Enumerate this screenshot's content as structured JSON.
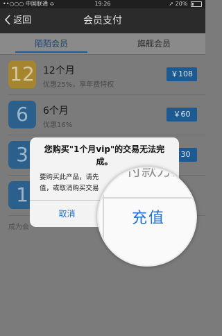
{
  "status_bar": {
    "carrier": "••○○○ 中国联通 ≎",
    "time": "19:26",
    "battery": "20%",
    "battery_level": 0.2
  },
  "nav": {
    "back_label": "返回",
    "title": "会员支付"
  },
  "tabs": [
    {
      "label": "陌陌会员",
      "active": true
    },
    {
      "label": "旗舰会员",
      "active": false
    }
  ],
  "products": [
    {
      "badge": "12",
      "badge_color": "#a5852d",
      "title": "12个月",
      "subtitle": "优惠25%，享年费特权",
      "price": "￥108"
    },
    {
      "badge": "6",
      "badge_color": "#2b5f8c",
      "title": "6个月",
      "subtitle": "优惠16%",
      "price": "￥60"
    },
    {
      "badge": "3",
      "badge_color": "#2b5f8c",
      "title": "",
      "subtitle": "",
      "price": "￥30"
    },
    {
      "badge": "1",
      "badge_color": "#2b5f8c",
      "title": "",
      "subtitle": "",
      "price": ""
    }
  ],
  "footer_note": "成为会",
  "alert": {
    "title": "您购买\"1个月vip\"的交易无法完成。",
    "message_line1": "要购买此产品，请先",
    "message_line2": "值，或取消购买交易",
    "cancel_label": "取消",
    "confirm_label": "充值"
  },
  "magnifier": {
    "peek_text": "付款方式",
    "label": "充值"
  },
  "colors": {
    "accent": "#1a72d6",
    "price_button": "#1c5a91",
    "nav_background": "#2b2b2b"
  }
}
